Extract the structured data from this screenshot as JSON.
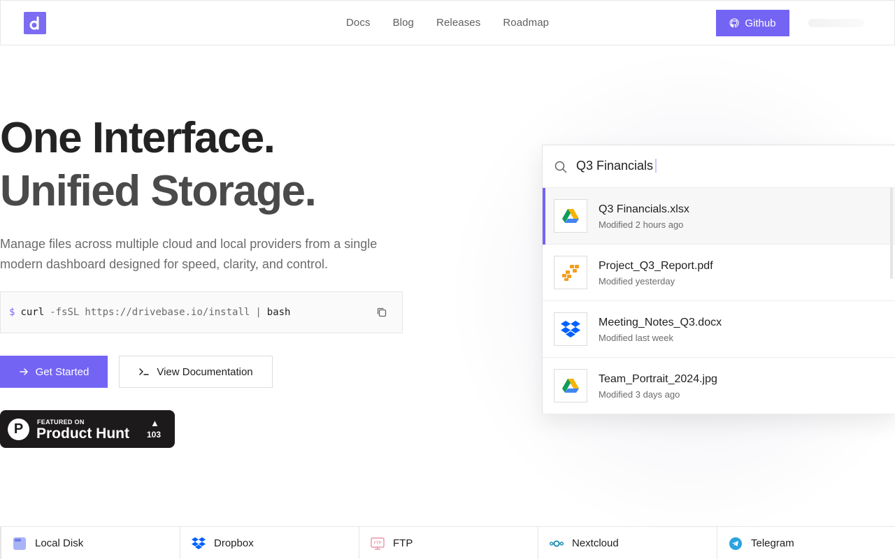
{
  "header": {
    "nav": [
      "Docs",
      "Blog",
      "Releases",
      "Roadmap"
    ],
    "github_label": "Github"
  },
  "hero": {
    "title_line1": "One Interface.",
    "title_line2": "Unified Storage.",
    "subtitle": "Manage files across multiple cloud and local providers from a single modern dashboard designed for speed, clarity, and control."
  },
  "install": {
    "prompt": "$",
    "cmd": "curl",
    "flag": "-fsSL",
    "url": "https://drivebase.io/install",
    "pipe": "|",
    "shell": "bash"
  },
  "actions": {
    "primary": "Get Started",
    "secondary": "View Documentation"
  },
  "product_hunt": {
    "featured": "FEATURED ON",
    "name": "Product Hunt",
    "count": "103"
  },
  "search": {
    "query": "Q3 Financials",
    "results": [
      {
        "name": "Q3 Financials.xlsx",
        "meta": "Modified 2 hours ago",
        "icon": "google-drive-icon"
      },
      {
        "name": "Project_Q3_Report.pdf",
        "meta": "Modified yesterday",
        "icon": "aws-s3-icon"
      },
      {
        "name": "Meeting_Notes_Q3.docx",
        "meta": "Modified last week",
        "icon": "dropbox-icon"
      },
      {
        "name": "Team_Portrait_2024.jpg",
        "meta": "Modified 3 days ago",
        "icon": "google-drive-icon"
      }
    ]
  },
  "providers": [
    {
      "name": "Local Disk",
      "icon": "local-disk-icon"
    },
    {
      "name": "Dropbox",
      "icon": "dropbox-icon"
    },
    {
      "name": "FTP",
      "icon": "ftp-icon"
    },
    {
      "name": "Nextcloud",
      "icon": "nextcloud-icon"
    },
    {
      "name": "Telegram",
      "icon": "telegram-icon"
    }
  ],
  "colors": {
    "accent": "#7464f4",
    "text": "#1f1f1f",
    "muted": "#6b6b6b"
  }
}
